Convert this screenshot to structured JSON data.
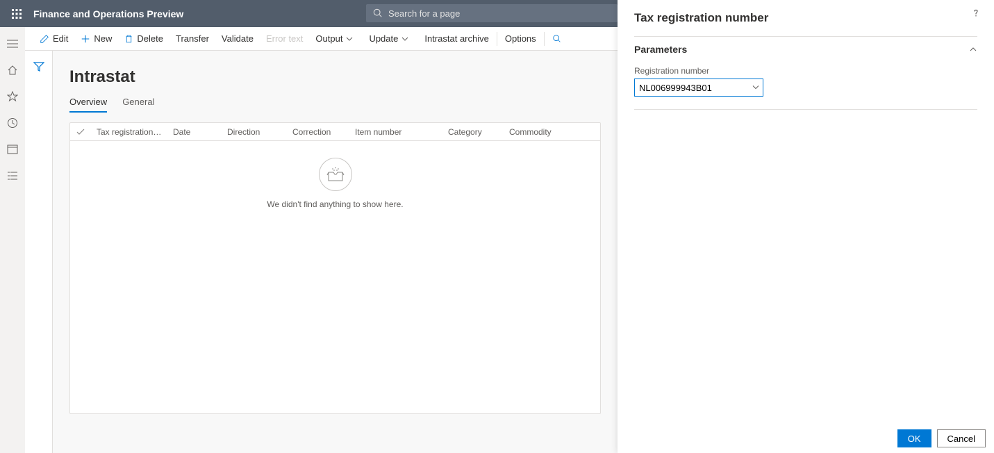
{
  "header": {
    "app_title": "Finance and Operations Preview",
    "search_placeholder": "Search for a page"
  },
  "actions": {
    "edit": "Edit",
    "new": "New",
    "delete": "Delete",
    "transfer": "Transfer",
    "validate": "Validate",
    "error_text": "Error text",
    "output": "Output",
    "update": "Update",
    "intrastat_archive": "Intrastat archive",
    "options": "Options"
  },
  "page": {
    "title": "Intrastat",
    "tabs": {
      "overview": "Overview",
      "general": "General"
    },
    "columns": {
      "tax_reg": "Tax registration num...",
      "date": "Date",
      "direction": "Direction",
      "correction": "Correction",
      "item_number": "Item number",
      "category": "Category",
      "commodity": "Commodity"
    },
    "empty_message": "We didn't find anything to show here."
  },
  "dialog": {
    "title": "Tax registration number",
    "section_title": "Parameters",
    "field_label": "Registration number",
    "field_value": "NL006999943B01",
    "ok": "OK",
    "cancel": "Cancel"
  }
}
